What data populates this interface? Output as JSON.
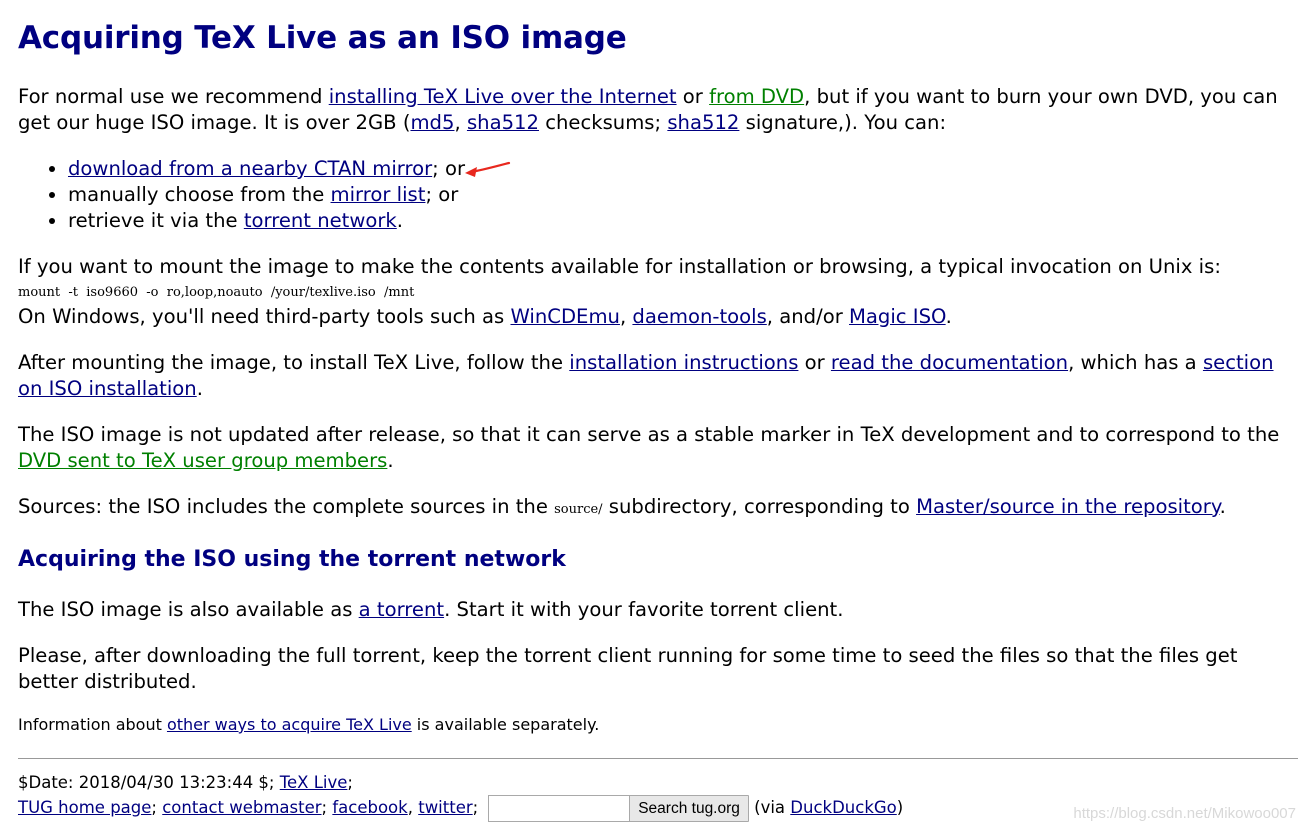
{
  "title": "Acquiring TeX Live as an ISO image",
  "intro": {
    "t1": "For normal use we recommend ",
    "link_internet": "installing TeX Live over the Internet",
    "t2": " or ",
    "link_dvd": "from DVD",
    "t3": ", but if you want to burn your own DVD, you can get our huge ISO image. It is over 2GB (",
    "link_md5": "md5",
    "t4": ", ",
    "link_sha512": "sha512",
    "t5": " checksums; ",
    "link_sha512_sig": "sha512",
    "t6": " signature,). You can:"
  },
  "options": [
    {
      "pre": "",
      "link": "download from a nearby CTAN mirror",
      "post": "; or"
    },
    {
      "pre": "manually choose from the ",
      "link": "mirror list",
      "post": "; or"
    },
    {
      "pre": "retrieve it via the ",
      "link": "torrent network",
      "post": "."
    }
  ],
  "mount": {
    "t1": "If you want to mount the image to make the contents available for installation or browsing, a typical invocation on Unix is:",
    "command": "mount  -t  iso9660  -o  ro,loop,noauto  /your/texlive.iso  /mnt",
    "t2": "On Windows, you'll need third-party tools such as ",
    "link_wincdemu": "WinCDEmu",
    "t3": ", ",
    "link_daemon": "daemon-tools",
    "t4": ", and/or ",
    "link_magic": "Magic ISO",
    "t5": "."
  },
  "after_mount": {
    "t1": "After mounting the image, to install TeX Live, follow the ",
    "link_instructions": "installation instructions",
    "t2": " or ",
    "link_docs": "read the documentation",
    "t3": ", which has a ",
    "link_section": "section on ISO installation",
    "t4": "."
  },
  "not_updated": {
    "t1": "The ISO image is not updated after release, so that it can serve as a stable marker in TeX development and to correspond to the ",
    "link_dvd_members": "DVD sent to TeX user group members",
    "t2": "."
  },
  "sources": {
    "t1": "Sources: the ISO includes the complete sources in the ",
    "code": "source/",
    "t2": " subdirectory, corresponding to ",
    "link_repo": "Master/source in the repository",
    "t3": "."
  },
  "torrent_heading": "Acquiring the ISO using the torrent network",
  "torrent": {
    "t1": "The ISO image is also available as ",
    "link_torrent": "a torrent",
    "t2": ". Start it with your favorite torrent client.",
    "seed": "Please, after downloading the full torrent, keep the torrent client running for some time to seed the files so that the files get better distributed."
  },
  "info": {
    "t1": "Information about ",
    "link_other": "other ways to acquire TeX Live",
    "t2": " is available separately."
  },
  "footer": {
    "date": "$Date: 2018/04/30 13:23:44 $; ",
    "link_texlive": "TeX Live",
    "sep1": ";",
    "link_tug": "TUG home page",
    "sep2": "; ",
    "link_webmaster": "contact webmaster",
    "sep3": "; ",
    "link_facebook": "facebook",
    "sep4": ", ",
    "link_twitter": "twitter",
    "sep5": ";",
    "search_value": "",
    "search_button": "Search tug.org",
    "via": " (via ",
    "link_ddg": "DuckDuckGo",
    "via_end": ")"
  },
  "watermark": "https://blog.csdn.net/Mikowoo007",
  "colors": {
    "heading": "#000080",
    "link": "#000080",
    "link_green": "#008000",
    "arrow": "#e8281e"
  }
}
